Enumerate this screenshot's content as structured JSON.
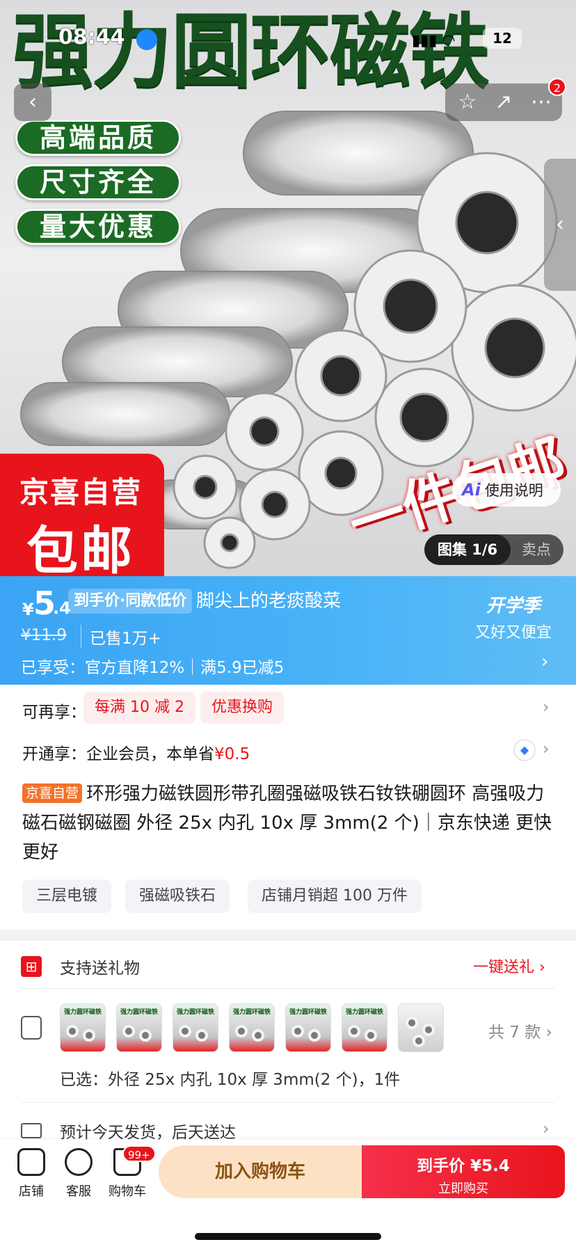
{
  "status_bar": {
    "time": "08:44",
    "battery": "12"
  },
  "hero": {
    "headline": "强力圆环磁铁",
    "pills": [
      "高端品质",
      "尺寸齐全",
      "量大优惠"
    ],
    "badge_line1": "京喜自营",
    "badge_line2": "包邮",
    "promo_text": "一件包邮",
    "ai_label": "使用说明",
    "gallery_label": "图集 1/6",
    "selling_points_label": "卖点",
    "share_badge": "2"
  },
  "price": {
    "currency": "¥",
    "integer": "5",
    "decimal": ".4",
    "tag": "到手价·同款低价",
    "username": "脚尖上的老痰酸菜",
    "original": "¥11.9",
    "sold": "已售1万+",
    "enjoy": "已享受：官方直降12%｜满5.9已减5",
    "campaign_title": "开学季",
    "campaign_sub": "又好又便宜"
  },
  "offers": {
    "more_label": "可再享：",
    "coupons": [
      "每满 10 减 2",
      "优惠换购"
    ],
    "vip_text": "开通享：企业会员，本单省",
    "vip_save": "¥0.5"
  },
  "product": {
    "badge": "京喜自营",
    "title": "环形强力磁铁圆形带孔圈强磁吸铁石钕铁硼圆环 高强吸力磁石磁钢磁圈 外径 25x 内孔 10x 厚 3mm(2 个)｜京东快递 更快更好",
    "chips": [
      "三层电镀",
      "强磁吸铁石",
      "店铺月销超 100 万件"
    ]
  },
  "gift": {
    "label": "支持送礼物",
    "link": "一键送礼"
  },
  "spec": {
    "thumb_caption": "强力圆环磁铁",
    "count": "共 7 款",
    "selected": "已选：外径 25x 内孔 10x 厚 3mm(2 个)，1件"
  },
  "shipping": {
    "text": "预计今天发货，后天送达"
  },
  "bottom": {
    "store": "店铺",
    "service": "客服",
    "cart": "购物车",
    "cart_badge": "99+",
    "add_cart": "加入购物车",
    "buy_price": "到手价 ¥5.4",
    "buy_now": "立即购买"
  },
  "colors": {
    "brand_red": "#e8141c",
    "price_blue": "#3ba4f4",
    "hero_green": "#17501f"
  }
}
